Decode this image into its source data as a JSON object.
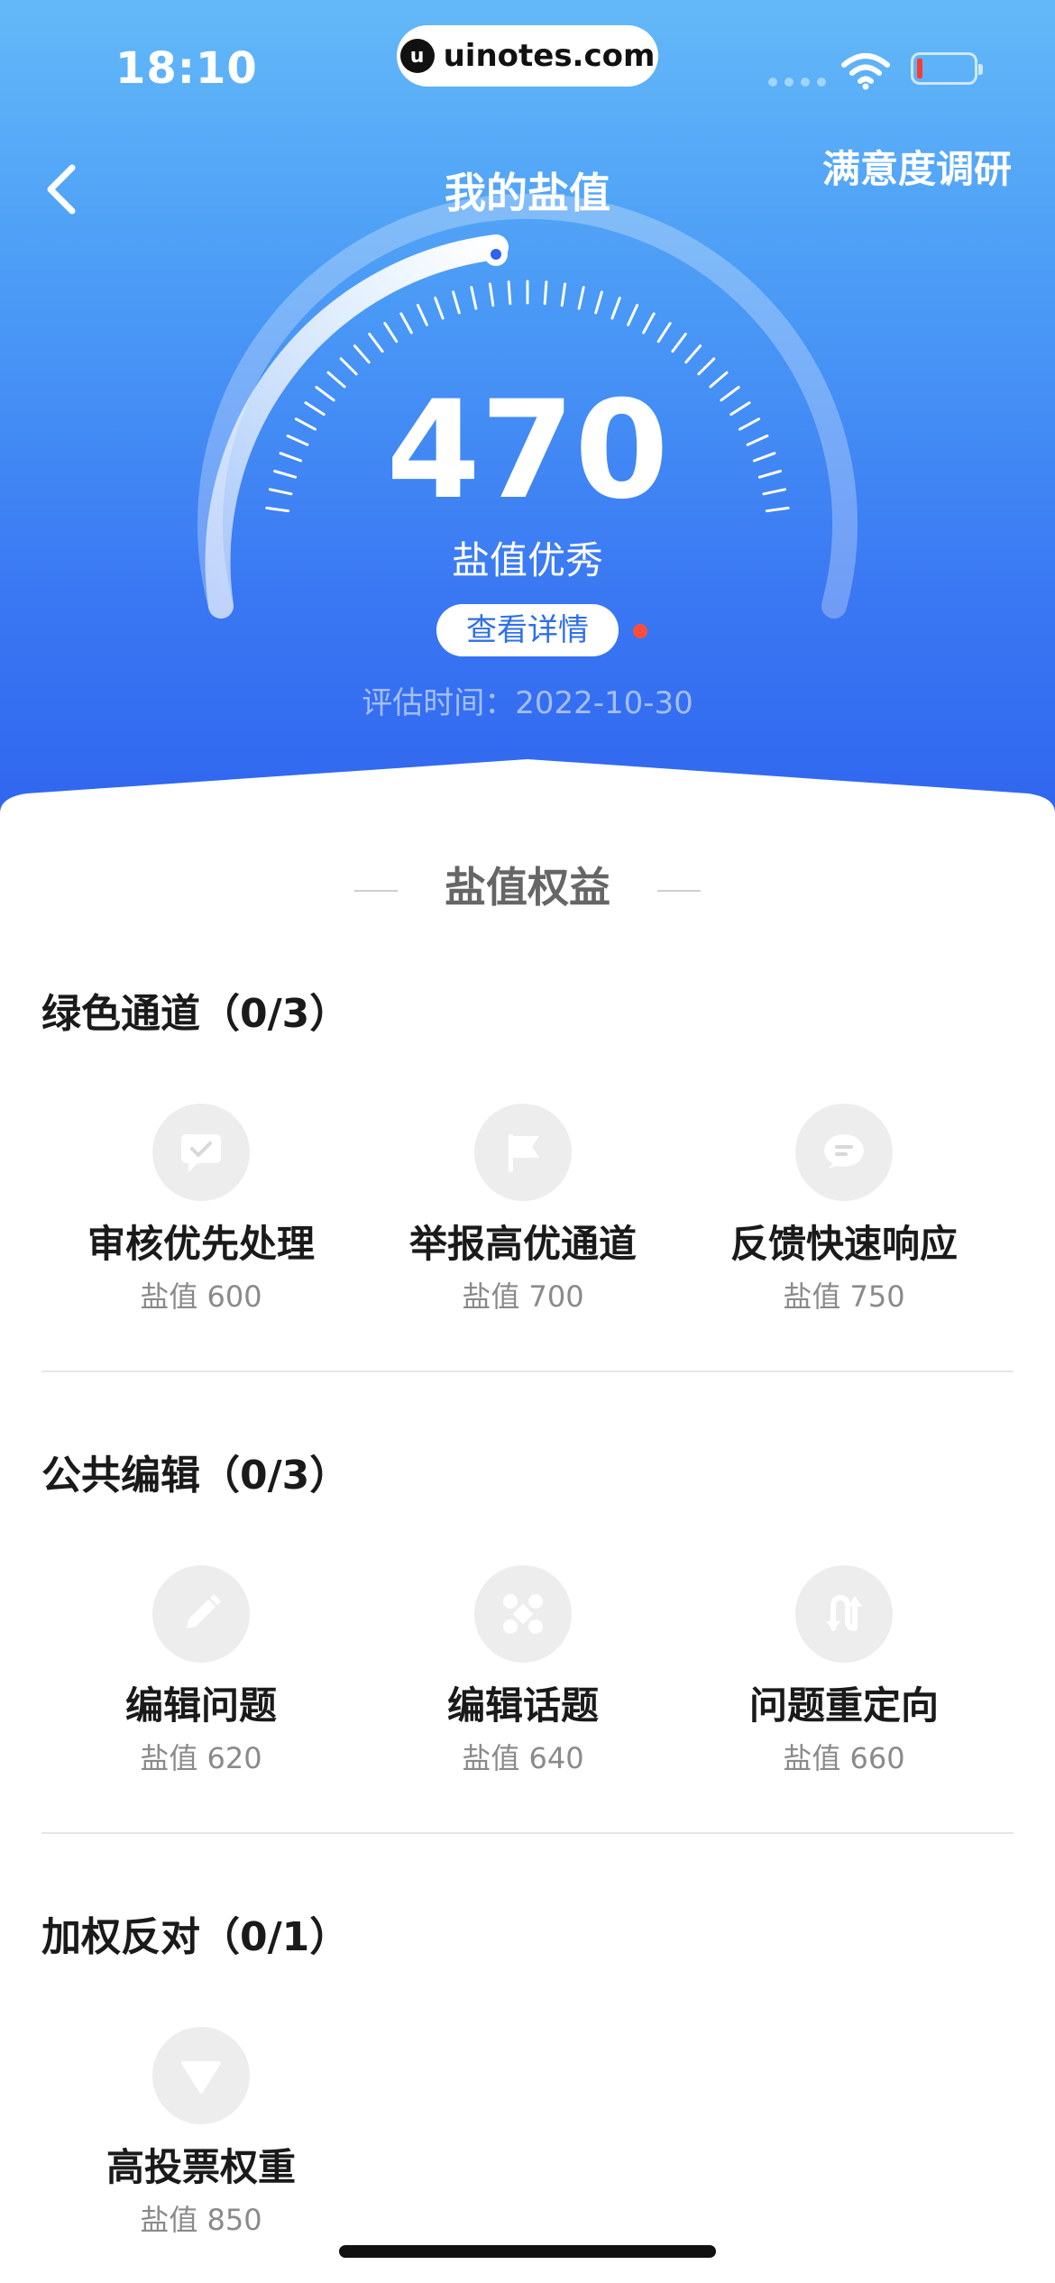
{
  "status_bar": {
    "time": "18:10",
    "site": "uinotes.com",
    "site_logo_letter": "u"
  },
  "nav": {
    "title": "我的盐值",
    "right_link": "满意度调研"
  },
  "gauge": {
    "score": "470",
    "label": "盐值优秀",
    "detail_button": "查看详情",
    "eval_time": "评估时间：2022-10-30",
    "accent": "#2f63ef"
  },
  "benefits": {
    "title": "盐值权益",
    "groups": [
      {
        "title": "绿色通道（0/3）",
        "items": [
          {
            "name": "审核优先处理",
            "value": "盐值 600",
            "icon": "chat-check-icon"
          },
          {
            "name": "举报高优通道",
            "value": "盐值 700",
            "icon": "flag-icon"
          },
          {
            "name": "反馈快速响应",
            "value": "盐值 750",
            "icon": "message-bubble-icon"
          }
        ]
      },
      {
        "title": "公共编辑（0/3）",
        "items": [
          {
            "name": "编辑问题",
            "value": "盐值 620",
            "icon": "pencil-icon"
          },
          {
            "name": "编辑话题",
            "value": "盐值 640",
            "icon": "nodes-icon"
          },
          {
            "name": "问题重定向",
            "value": "盐值 660",
            "icon": "redirect-icon"
          }
        ]
      },
      {
        "title": "加权反对（0/1）",
        "items": [
          {
            "name": "高投票权重",
            "value": "盐值 850",
            "icon": "down-triangle-icon"
          }
        ]
      }
    ]
  }
}
